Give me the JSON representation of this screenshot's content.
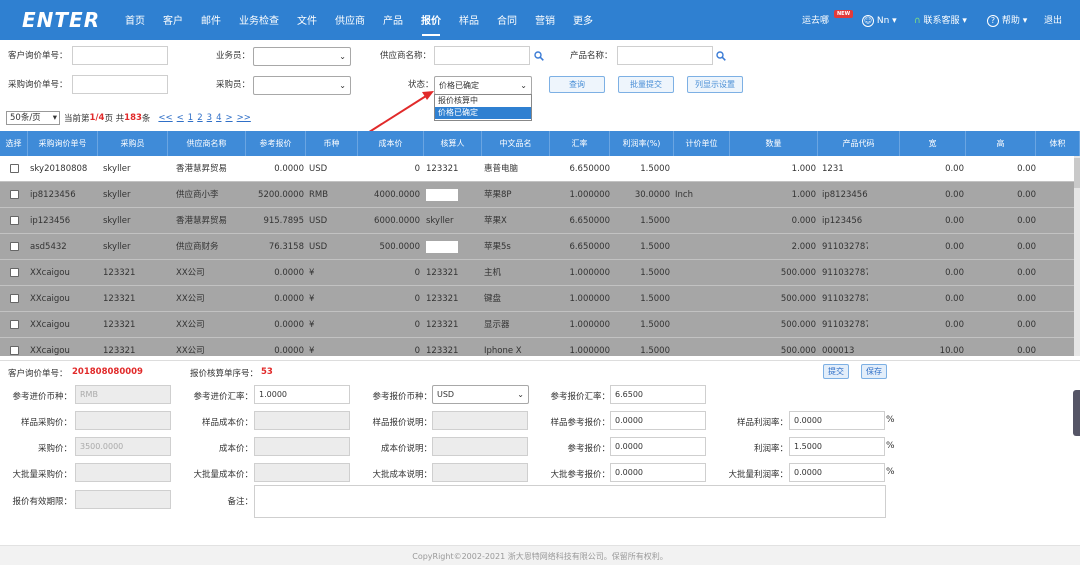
{
  "nav": {
    "logo": "ENTER",
    "items": [
      "首页",
      "客户",
      "邮件",
      "业务检查",
      "文件",
      "供应商",
      "产品",
      "报价",
      "样品",
      "合同",
      "营销",
      "更多"
    ],
    "active_index": 7,
    "promo": "运去哪",
    "promo_badge": "NEW",
    "user": "Nn",
    "support": "联系客服",
    "help": "帮助",
    "logout": "退出"
  },
  "filters": {
    "customer_inquiry_no_label": "客户询价单号：",
    "salesperson_label": "业务员：",
    "supplier_name_label": "供应商名称：",
    "product_name_label": "产品名称：",
    "purchase_inquiry_no_label": "采购询价单号：",
    "buyer_label": "采购员：",
    "status_label": "状态：",
    "status_value": "价格已确定",
    "status_options": [
      "报价核算中",
      "价格已确定"
    ],
    "status_selected_option": 1,
    "query_button": "查询",
    "batch_submit_button": "批量提交",
    "column_settings_button": "列显示设置"
  },
  "pager": {
    "page_size": "50条/页",
    "current_prefix": "当前第",
    "current": "1/4",
    "current_suffix": "页 共",
    "total": "183",
    "total_suffix": "条",
    "first": "<<",
    "prev": "<",
    "pages": [
      "1",
      "2",
      "3",
      "4"
    ],
    "next": ">",
    "last": ">>"
  },
  "table": {
    "headers": [
      "选择",
      "采购询价单号",
      "采购员",
      "供应商名称",
      "参考报价",
      "币种",
      "成本价",
      "核算人",
      "中文品名",
      "汇率",
      "利润率(%)",
      "计价单位",
      "数量",
      "产品代码",
      "宽",
      "高",
      "体积"
    ],
    "rows": [
      [
        "sky20180808",
        "skyller",
        "香港慧昇贸易",
        "0.0000",
        "USD",
        "0",
        "123321",
        "惠普电脑",
        "6.650000",
        "1.5000",
        "",
        "1.000",
        "1231",
        "0.00",
        "0.00"
      ],
      [
        "ip8123456",
        "skyller",
        "供应商小李",
        "5200.0000",
        "RMB",
        "4000.0000",
        "",
        "苹果8P",
        "1.000000",
        "30.0000",
        "Inch",
        "1.000",
        "ip8123456",
        "0.00",
        "0.00"
      ],
      [
        "ip123456",
        "skyller",
        "香港慧昇贸易",
        "915.7895",
        "USD",
        "6000.0000",
        "skyller",
        "苹果X",
        "6.650000",
        "1.5000",
        "",
        "0.000",
        "ip123456",
        "0.00",
        "0.00"
      ],
      [
        "asd5432",
        "skyller",
        "供应商财务",
        "76.3158",
        "USD",
        "500.0000",
        "",
        "苹果5s",
        "6.650000",
        "1.5000",
        "",
        "2.000",
        "9110327871582",
        "0.00",
        "0.00"
      ],
      [
        "XXcaigou",
        "123321",
        "XX公司",
        "0.0000",
        "¥",
        "0",
        "123321",
        "主机",
        "1.000000",
        "1.5000",
        "",
        "500.000",
        "9110327871582",
        "0.00",
        "0.00"
      ],
      [
        "XXcaigou",
        "123321",
        "XX公司",
        "0.0000",
        "¥",
        "0",
        "123321",
        "键盘",
        "1.000000",
        "1.5000",
        "",
        "500.000",
        "9110327871582",
        "0.00",
        "0.00"
      ],
      [
        "XXcaigou",
        "123321",
        "XX公司",
        "0.0000",
        "¥",
        "0",
        "123321",
        "显示器",
        "1.000000",
        "1.5000",
        "",
        "500.000",
        "9110327871582",
        "0.00",
        "0.00"
      ],
      [
        "XXcaigou",
        "123321",
        "XX公司",
        "0.0000",
        "¥",
        "0",
        "123321",
        "Iphone X",
        "1.000000",
        "1.5000",
        "",
        "500.000",
        "000013",
        "10.00",
        "0.00"
      ]
    ]
  },
  "detail": {
    "customer_inquiry_label": "客户询价单号：",
    "customer_inquiry_value": "201808080009",
    "quote_calc_label": "报价核算单序号：",
    "quote_calc_value": "53",
    "submit_button": "提交",
    "save_button": "保存",
    "ref_purchase_currency_label": "参考进价币种：",
    "ref_purchase_currency_value": "RMB",
    "ref_purchase_rate_label": "参考进价汇率：",
    "ref_purchase_rate_value": "1.0000",
    "ref_quote_currency_label": "参考报价币种：",
    "ref_quote_currency_value": "USD",
    "ref_quote_rate_label": "参考报价汇率：",
    "ref_quote_rate_value": "6.6500",
    "sample_purchase_label": "样品采购价：",
    "sample_cost_label": "样品成本价：",
    "sample_quote_note_label": "样品报价说明：",
    "sample_ref_quote_label": "样品参考报价：",
    "sample_ref_quote_value": "0.0000",
    "sample_margin_label": "样品利润率：",
    "sample_margin_value": "0.0000",
    "purchase_price_label": "采购价：",
    "purchase_price_value": "3500.0000",
    "cost_price_label": "成本价：",
    "cost_note_label": "成本价说明：",
    "ref_quote_label": "参考报价：",
    "ref_quote_value": "0.0000",
    "margin_label": "利润率：",
    "margin_value": "1.5000",
    "bulk_purchase_label": "大批量采购价：",
    "bulk_cost_label": "大批量成本价：",
    "bulk_cost_note_label": "大批成本说明：",
    "bulk_ref_quote_label": "大批参考报价：",
    "bulk_ref_quote_value": "0.0000",
    "bulk_margin_label": "大批量利润率：",
    "bulk_margin_value": "0.0000",
    "validity_label": "报价有效期限：",
    "remark_label": "备注：",
    "percent": "%"
  },
  "footer": "CopyRight©2002-2021 浙大恩特网络科技有限公司。保留所有权利。",
  "colors": {
    "nav_bg": "#2f80d1",
    "header_bg": "#3f8bd8",
    "accent_red": "#e12a2a"
  }
}
